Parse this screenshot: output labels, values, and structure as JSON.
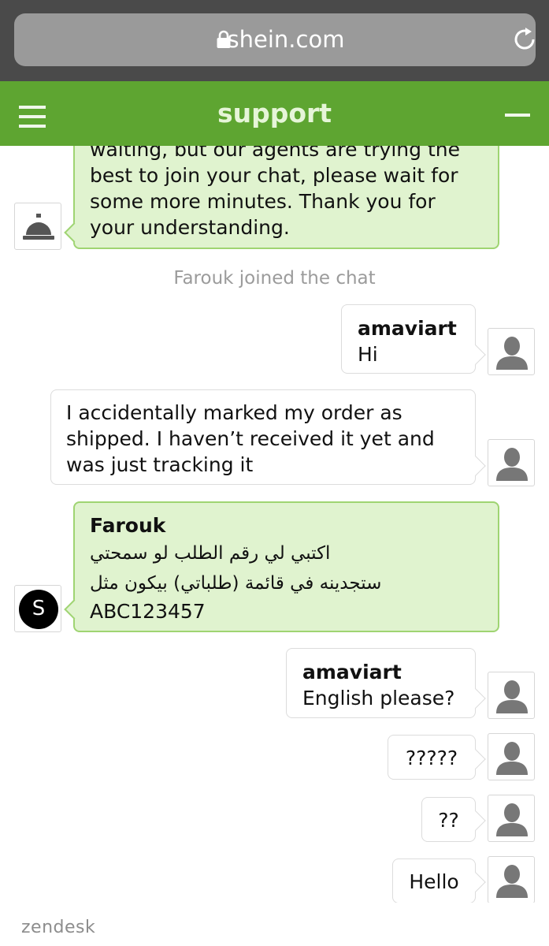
{
  "browser": {
    "url": "shein.com"
  },
  "header": {
    "title": "support"
  },
  "messages": {
    "bot": {
      "lines": [
        "waiting, but our agents are trying the",
        "best to join your chat, please wait for",
        "some more minutes. Thank you for",
        "your understanding."
      ]
    },
    "system": "Farouk joined the chat",
    "m1": {
      "sender": "amaviart",
      "text": "Hi"
    },
    "m2": {
      "lines": [
        "I accidentally marked my order as",
        "shipped. I haven’t received it yet and",
        "was just tracking it"
      ]
    },
    "m3": {
      "sender": "Farouk",
      "lines": [
        "اكتبي لي رقم الطلب لو سمحتي",
        "ستجدينه في قائمة (طلباتي) بيكون مثل",
        "ABC123457"
      ],
      "avatar_letter": "S"
    },
    "m4": {
      "sender": "amaviart",
      "text": "English please?"
    },
    "m5": {
      "text": "?????"
    },
    "m6": {
      "text": "??"
    },
    "m7": {
      "text": "Hello"
    }
  },
  "footer": {
    "brand": "zendesk"
  },
  "colors": {
    "browser_chrome": "#4a4a4a",
    "header_green": "#5ea531",
    "agent_bubble": "#e0f3cf",
    "agent_border": "#9fd472"
  },
  "icons": {
    "lock": "lock-icon",
    "reload": "reload-icon",
    "menu": "hamburger-menu-icon",
    "minimize": "minimize-icon",
    "bell": "service-bell-icon",
    "user": "user-silhouette-icon"
  }
}
